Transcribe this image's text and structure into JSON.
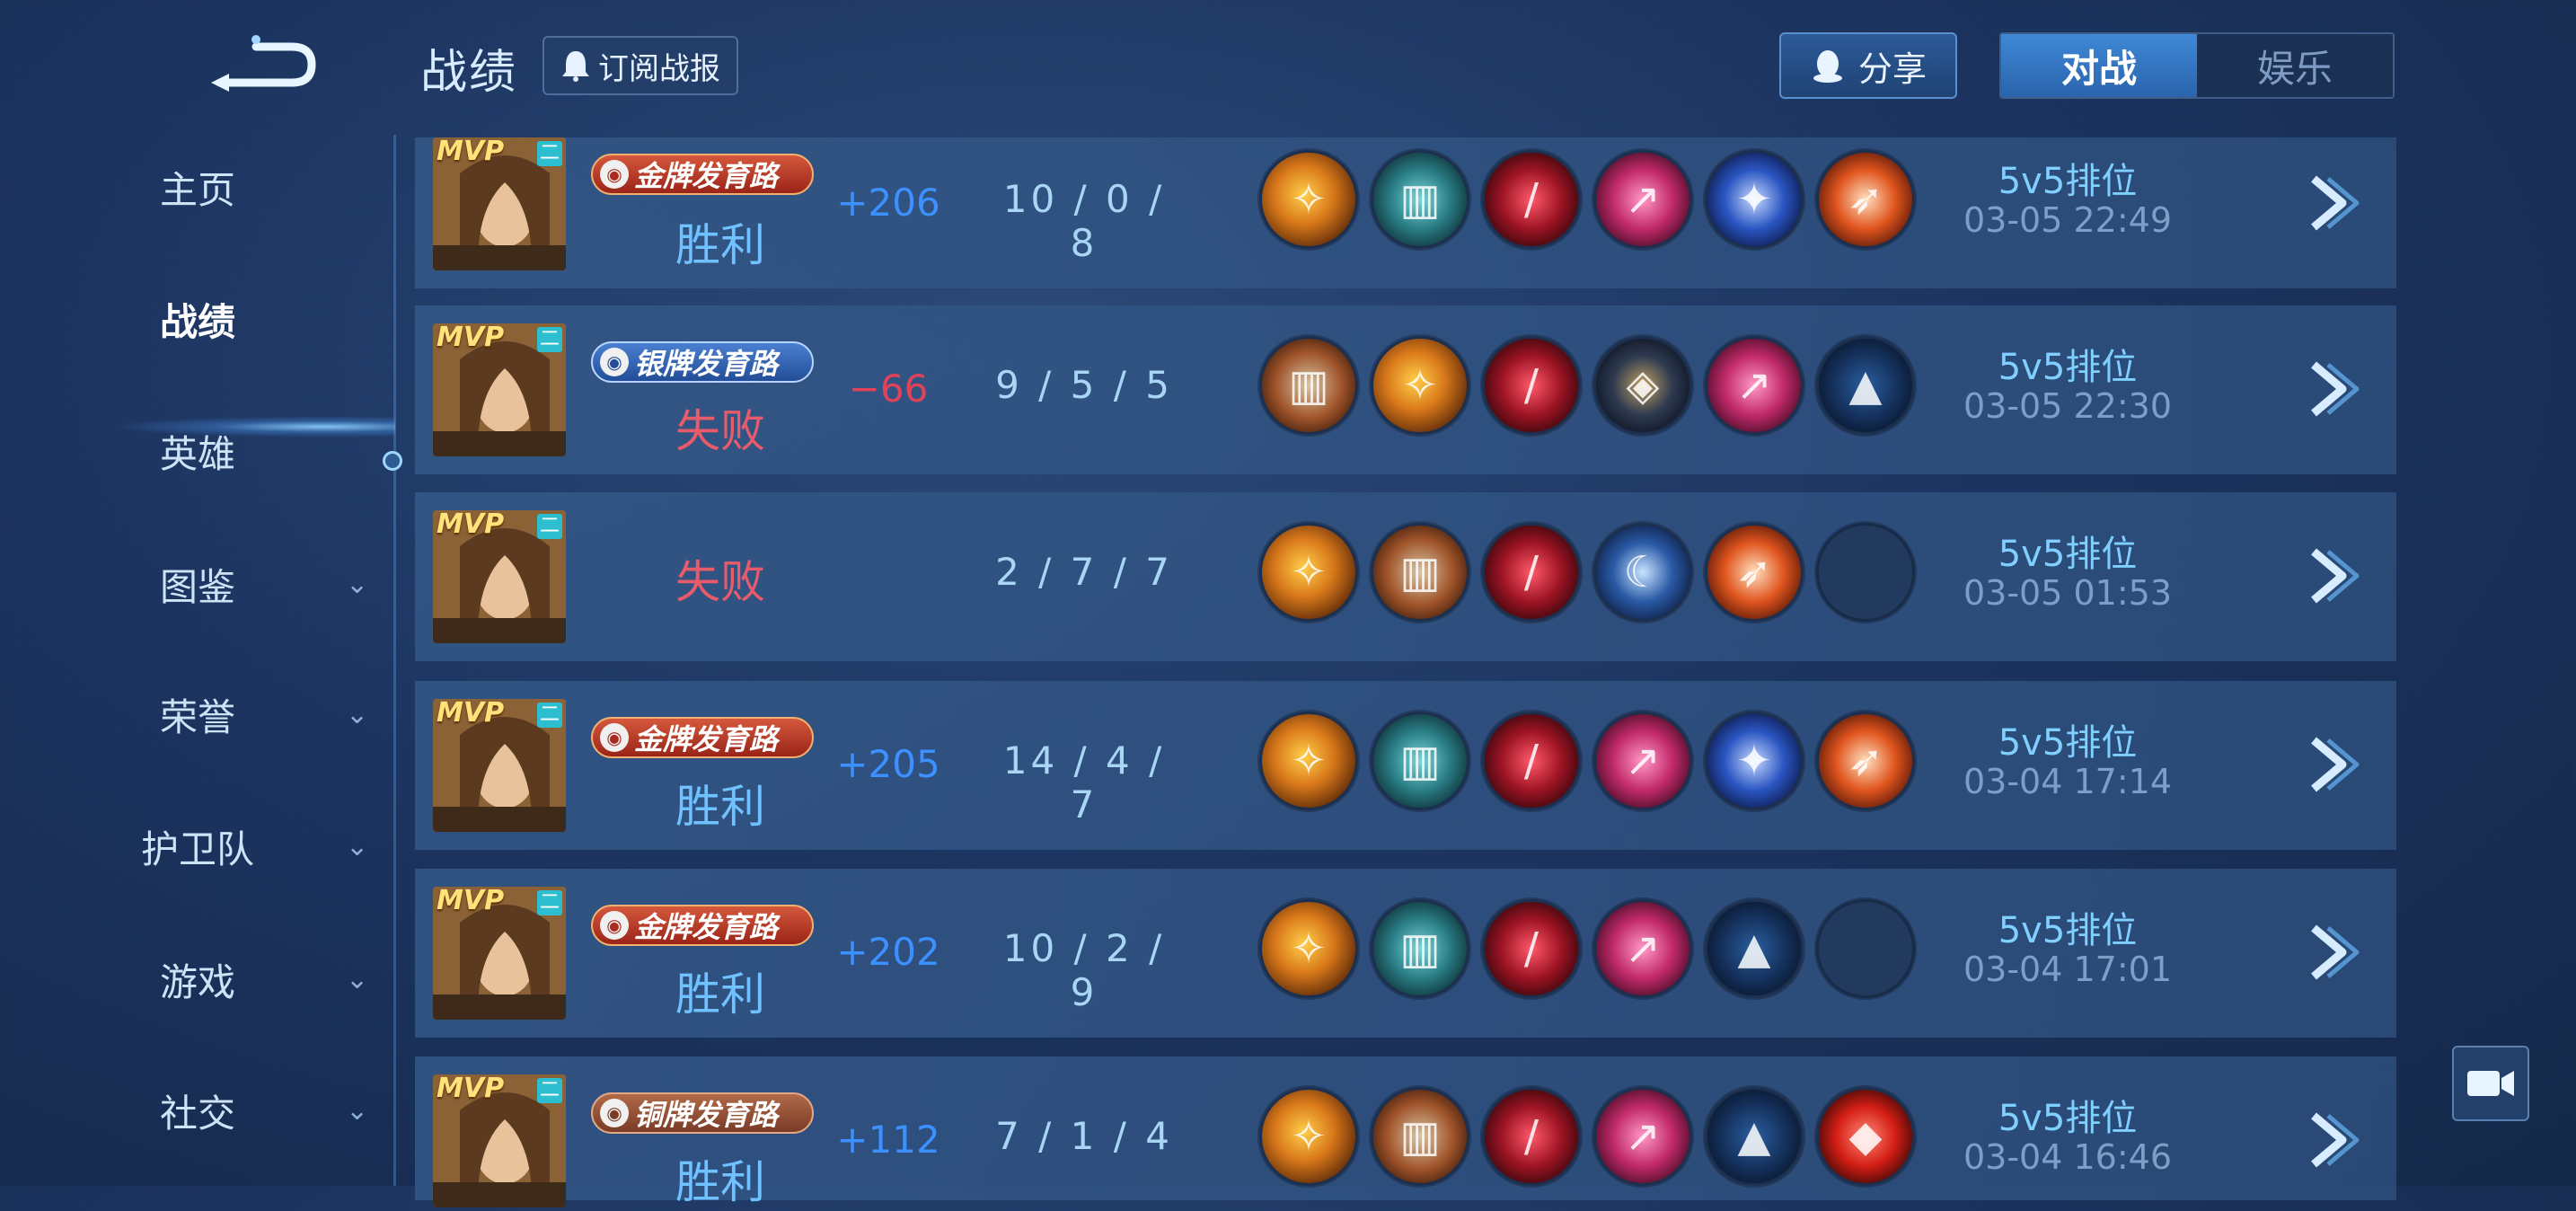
{
  "header": {
    "title": "战绩",
    "subscribe_label": "订阅战报",
    "share_label": "分享",
    "tabs": [
      {
        "label": "对战",
        "active": true
      },
      {
        "label": "娱乐",
        "active": false
      }
    ]
  },
  "sidebar": {
    "items": [
      {
        "label": "主页",
        "has_chevron": false,
        "active": false
      },
      {
        "label": "战绩",
        "has_chevron": false,
        "active": true
      },
      {
        "label": "英雄",
        "has_chevron": false,
        "active": false
      },
      {
        "label": "图鉴",
        "has_chevron": true,
        "active": false
      },
      {
        "label": "荣誉",
        "has_chevron": true,
        "active": false
      },
      {
        "label": "护卫队",
        "has_chevron": true,
        "active": false
      },
      {
        "label": "游戏",
        "has_chevron": true,
        "active": false
      },
      {
        "label": "社交",
        "has_chevron": true,
        "active": false
      }
    ]
  },
  "matches": [
    {
      "mvp": "MVP",
      "level_badge": "二",
      "title_badge": "金牌发育路",
      "badge_tier": "gold",
      "result": "胜利",
      "result_type": "win",
      "score": "+206",
      "kda": "10 / 0 / 8",
      "mode": "5v5排位",
      "time": "03-05  22:49",
      "equipment": [
        "wing-item",
        "boots-teal-item",
        "red-claw-item",
        "pink-blade-item",
        "blue-trident-item",
        "orange-spear-item"
      ]
    },
    {
      "mvp": "MVP",
      "level_badge": "二",
      "title_badge": "银牌发育路",
      "badge_tier": "silver",
      "result": "失败",
      "result_type": "lose",
      "score": "−66",
      "kda": "9 / 5 / 5",
      "mode": "5v5排位",
      "time": "03-05  22:30",
      "equipment": [
        "boots-orange-item",
        "wing-item",
        "red-claw-item",
        "dark-armor-item",
        "pink-blade-item",
        "green-cloak-item"
      ]
    },
    {
      "mvp": "MVP",
      "level_badge": "二",
      "title_badge": "",
      "badge_tier": "",
      "result": "失败",
      "result_type": "lose",
      "score": "",
      "kda": "2 / 7 / 7",
      "mode": "5v5排位",
      "time": "03-05  01:53",
      "equipment": [
        "wing-item",
        "boots-orange-item",
        "red-claw-item",
        "blue-bow-item",
        "orange-spear-item",
        "empty-slot"
      ]
    },
    {
      "mvp": "MVP",
      "level_badge": "二",
      "title_badge": "金牌发育路",
      "badge_tier": "gold",
      "result": "胜利",
      "result_type": "win",
      "score": "+205",
      "kda": "14 / 4 / 7",
      "mode": "5v5排位",
      "time": "03-04  17:14",
      "equipment": [
        "wing-item",
        "boots-teal-item",
        "red-claw-item",
        "pink-blade-item",
        "blue-trident-item",
        "orange-spear-item"
      ]
    },
    {
      "mvp": "MVP",
      "level_badge": "二",
      "title_badge": "金牌发育路",
      "badge_tier": "gold",
      "result": "胜利",
      "result_type": "win",
      "score": "+202",
      "kda": "10 / 2 / 9",
      "mode": "5v5排位",
      "time": "03-04  17:01",
      "equipment": [
        "wing-item",
        "boots-teal-item",
        "red-claw-item",
        "pink-blade-item",
        "green-cloak-item",
        "empty-slot"
      ]
    },
    {
      "mvp": "MVP",
      "level_badge": "二",
      "title_badge": "铜牌发育路",
      "badge_tier": "bronze",
      "result": "胜利",
      "result_type": "win",
      "score": "+112",
      "kda": "7 / 1 / 4",
      "mode": "5v5排位",
      "time": "03-04  16:46",
      "equipment": [
        "wing-item",
        "boots-orange-item",
        "red-claw-item",
        "pink-blade-item",
        "green-cloak-item",
        "red-gem-item"
      ]
    }
  ],
  "colors": {
    "win": "#6fc2ff",
    "lose": "#e85b6a",
    "score_pos": "#3c90ff",
    "score_neg": "#e0425a",
    "accent": "#3f88d6"
  }
}
